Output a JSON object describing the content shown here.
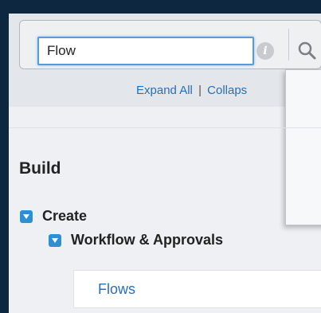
{
  "search": {
    "value": "Flow",
    "info_glyph": "i"
  },
  "tree_controls": {
    "expand_all": "Expand All",
    "separator": "|",
    "collapse_all": "Collaps"
  },
  "build": {
    "title": "Build",
    "items": [
      {
        "label": "Create",
        "expanded": true
      },
      {
        "label": "Workflow & Approvals",
        "expanded": true
      }
    ],
    "leaf": {
      "label": "Flows"
    }
  },
  "colors": {
    "accent": "#2e8fd2",
    "link": "#2a6fb0",
    "focus_border": "#5a9ad6"
  },
  "icons": {
    "info": "info-icon",
    "search": "magnifier-icon",
    "toggle": "triangle-down-icon"
  }
}
